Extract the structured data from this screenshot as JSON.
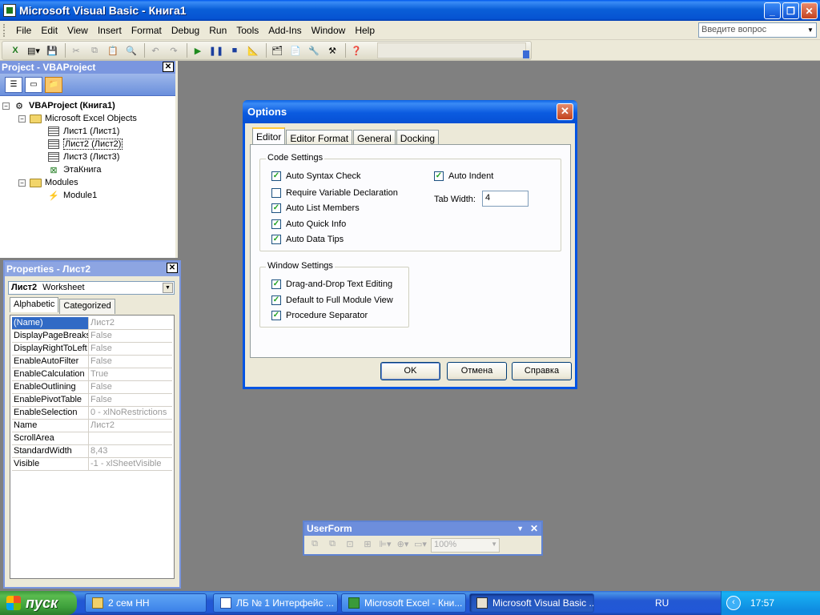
{
  "window": {
    "title": "Microsoft Visual Basic - Книга1"
  },
  "menu": [
    {
      "label": "File"
    },
    {
      "label": "Edit"
    },
    {
      "label": "View"
    },
    {
      "label": "Insert"
    },
    {
      "label": "Format"
    },
    {
      "label": "Debug"
    },
    {
      "label": "Run"
    },
    {
      "label": "Tools"
    },
    {
      "label": "Add-Ins"
    },
    {
      "label": "Window"
    },
    {
      "label": "Help"
    }
  ],
  "help_search": {
    "placeholder": "Введите вопрос"
  },
  "project": {
    "title": "Project - VBAProject",
    "tree": {
      "root": "VBAProject (Книга1)",
      "folder_objects": "Microsoft Excel Objects",
      "sheet1": "Лист1 (Лист1)",
      "sheet2": "Лист2 (Лист2)",
      "sheet3": "Лист3 (Лист3)",
      "workbook": "ЭтаКнига",
      "folder_modules": "Modules",
      "module1": "Module1"
    }
  },
  "properties": {
    "title": "Properties - Лист2",
    "object_name": "Лист2",
    "object_type": "Worksheet",
    "tabs": {
      "alphabetic": "Alphabetic",
      "categorized": "Categorized"
    },
    "rows": [
      {
        "name": "(Name)",
        "value": "Лист2"
      },
      {
        "name": "DisplayPageBreaks",
        "value": "False"
      },
      {
        "name": "DisplayRightToLeft",
        "value": "False"
      },
      {
        "name": "EnableAutoFilter",
        "value": "False"
      },
      {
        "name": "EnableCalculation",
        "value": "True"
      },
      {
        "name": "EnableOutlining",
        "value": "False"
      },
      {
        "name": "EnablePivotTable",
        "value": "False"
      },
      {
        "name": "EnableSelection",
        "value": "0 - xlNoRestrictions"
      },
      {
        "name": "Name",
        "value": "Лист2"
      },
      {
        "name": "ScrollArea",
        "value": ""
      },
      {
        "name": "StandardWidth",
        "value": "8,43"
      },
      {
        "name": "Visible",
        "value": "-1 - xlSheetVisible"
      }
    ]
  },
  "options": {
    "title": "Options",
    "tabs": {
      "editor": "Editor",
      "editor_format": "Editor Format",
      "general": "General",
      "docking": "Docking"
    },
    "code_settings": {
      "label": "Code Settings",
      "auto_syntax": "Auto Syntax Check",
      "require_var": "Require Variable Declaration",
      "auto_list": "Auto List Members",
      "auto_quick": "Auto Quick Info",
      "auto_tips": "Auto Data Tips",
      "auto_indent": "Auto Indent",
      "tab_width_label": "Tab Width:",
      "tab_width": "4"
    },
    "window_settings": {
      "label": "Window Settings",
      "drag_drop": "Drag-and-Drop Text Editing",
      "full_module": "Default to Full Module View",
      "proc_sep": "Procedure Separator"
    },
    "buttons": {
      "ok": "OK",
      "cancel": "Отмена",
      "help": "Справка"
    }
  },
  "userform_toolbar": {
    "title": "UserForm",
    "zoom": "100%"
  },
  "taskbar": {
    "start": "пуск",
    "tasks": {
      "t1": "2 сем НН",
      "t2": "ЛБ № 1 Интерфейс ...",
      "t3": "Microsoft Excel - Кни...",
      "t4": "Microsoft Visual Basic ..."
    },
    "lang": "RU",
    "clock": "17:57"
  }
}
